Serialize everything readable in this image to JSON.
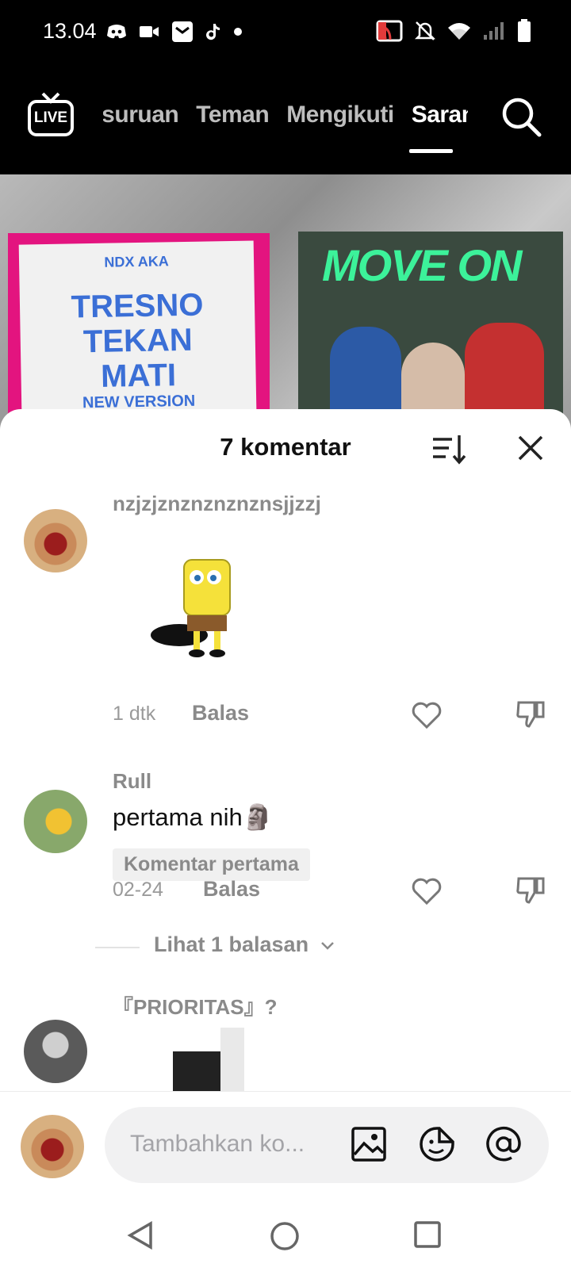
{
  "status_bar": {
    "time": "13.04"
  },
  "top_nav": {
    "live_label": "LIVE",
    "tabs": [
      {
        "label": "asuruan",
        "active": false
      },
      {
        "label": "Teman",
        "active": false
      },
      {
        "label": "Mengikuti",
        "active": false
      },
      {
        "label": "Saran",
        "active": true
      }
    ]
  },
  "video": {
    "poster1_lines": [
      "TRESNO",
      "TEKAN",
      "MATI",
      "NEW VERSION"
    ],
    "poster1_small": "NDX AKA",
    "poster2_title": "MOVE ON"
  },
  "comments_sheet": {
    "title": "7 komentar",
    "comments": [
      {
        "username": "nzjzjznznznznznsjjzzj",
        "text": "",
        "time": "1 dtk",
        "reply_label": "Balas"
      },
      {
        "username": "Rull",
        "text": "pertama nih🗿",
        "badge": "Komentar pertama",
        "time": "02-24",
        "reply_label": "Balas",
        "view_replies": "Lihat 1 balasan"
      },
      {
        "username": "『PRIORITAS』?",
        "text": ""
      }
    ],
    "input_placeholder": "Tambahkan ko..."
  },
  "colors": {
    "accent": "#ffffff",
    "sheet_bg": "#ffffff",
    "muted_text": "#8a8a8a"
  }
}
